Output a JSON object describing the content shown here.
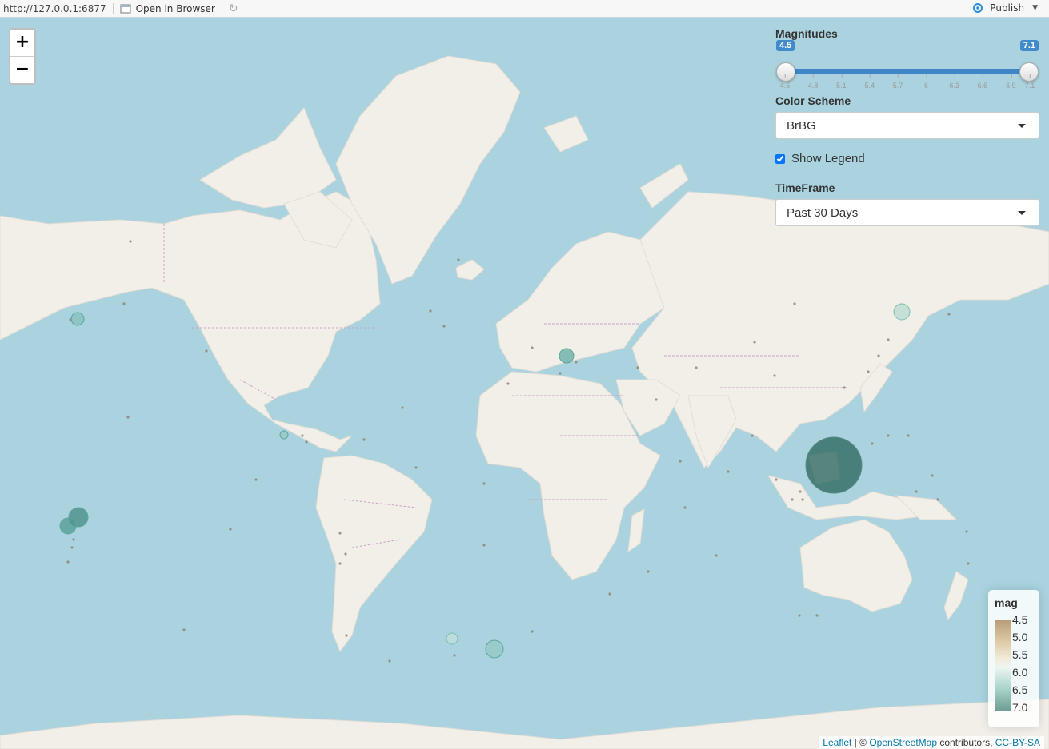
{
  "topbar": {
    "url": "http://127.0.0.1:6877",
    "open_browser": "Open in Browser",
    "publish": "Publish"
  },
  "map": {
    "zoom_in": "+",
    "zoom_out": "−"
  },
  "controls": {
    "magnitudes": {
      "label": "Magnitudes",
      "min_value": "4.5",
      "max_value": "7.1",
      "ticks": [
        "4.5",
        "4.8",
        "5.1",
        "5.4",
        "5.7",
        "6",
        "6.3",
        "6.6",
        "6.9",
        "7.1"
      ],
      "accent": "#428bca"
    },
    "color_scheme": {
      "label": "Color Scheme",
      "selected": "BrBG"
    },
    "show_legend": {
      "label": "Show Legend",
      "checked": true
    },
    "timeframe": {
      "label": "TimeFrame",
      "selected": "Past 30 Days"
    }
  },
  "legend": {
    "title": "mag",
    "labels": [
      "4.5",
      "5.0",
      "5.5",
      "6.0",
      "6.5",
      "7.0"
    ]
  },
  "attribution": {
    "leaflet": "Leaflet",
    "sep": "| ©",
    "osm": "OpenStreetMap",
    "contributors": "contributors,",
    "license": "CC-BY-SA"
  },
  "colors": {
    "water": "#aad3df",
    "land": "#f2efe9",
    "borders": "#c8a3c6",
    "quake_large": "#2f6a62",
    "quake_mid": "#5aa79d",
    "quake_small": "#8c7f6e"
  }
}
